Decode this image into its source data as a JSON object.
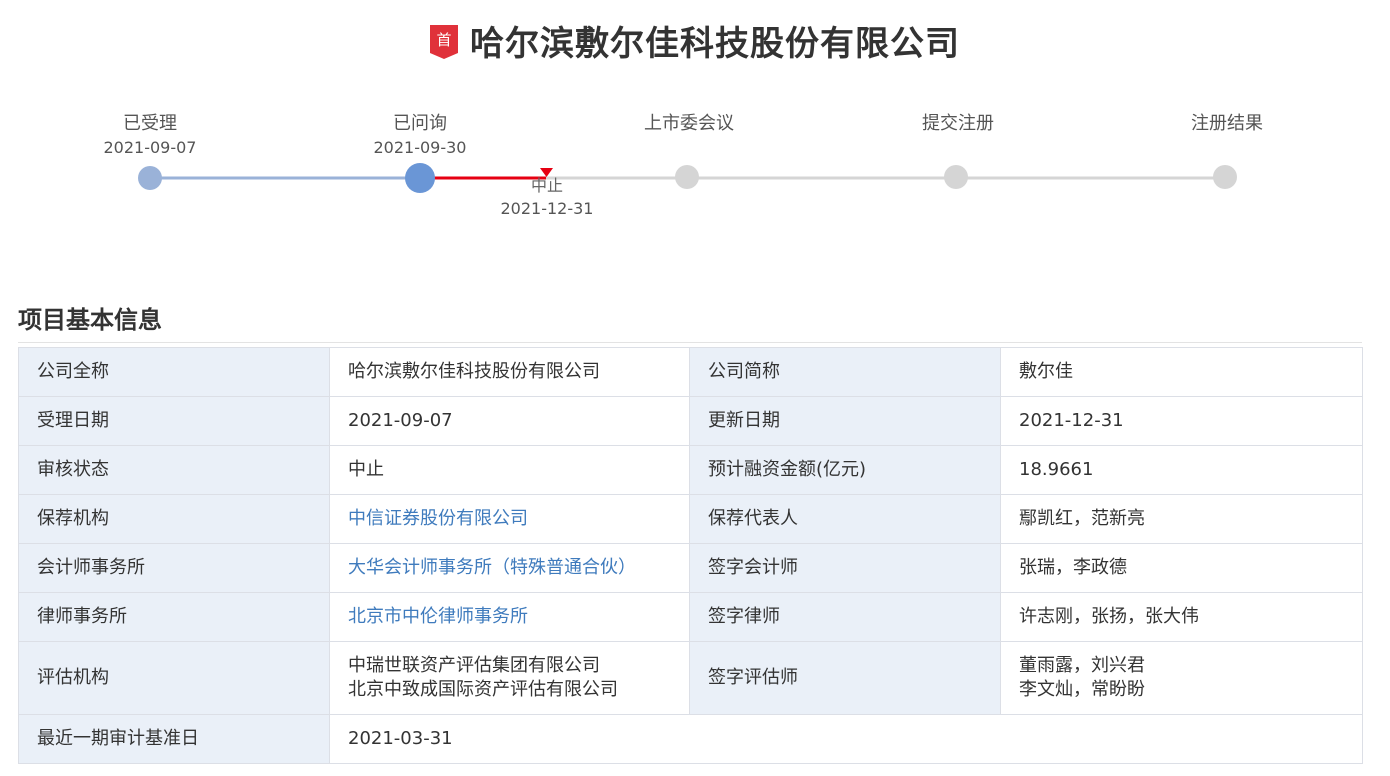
{
  "header": {
    "badge": "首",
    "title": "哈尔滨敷尔佳科技股份有限公司"
  },
  "timeline": {
    "stages": [
      {
        "name": "已受理",
        "date": "2021-09-07",
        "status": "done"
      },
      {
        "name": "已问询",
        "date": "2021-09-30",
        "status": "current"
      },
      {
        "name": "上市委会议",
        "date": "",
        "status": "pending"
      },
      {
        "name": "提交注册",
        "date": "",
        "status": "pending"
      },
      {
        "name": "注册结果",
        "date": "",
        "status": "pending"
      }
    ],
    "halt": {
      "name": "中止",
      "date": "2021-12-31"
    }
  },
  "section": {
    "title": "项目基本信息"
  },
  "info": {
    "rows": [
      {
        "k1": "公司全称",
        "v1": "哈尔滨敷尔佳科技股份有限公司",
        "k2": "公司简称",
        "v2": "敷尔佳"
      },
      {
        "k1": "受理日期",
        "v1": "2021-09-07",
        "k2": "更新日期",
        "v2": "2021-12-31"
      },
      {
        "k1": "审核状态",
        "v1": "中止",
        "k2": "预计融资金额(亿元)",
        "v2": "18.9661"
      },
      {
        "k1": "保荐机构",
        "v1": "中信证券股份有限公司",
        "k2": "保荐代表人",
        "v2": "鄢凯红，范新亮"
      },
      {
        "k1": "会计师事务所",
        "v1": "大华会计师事务所（特殊普通合伙）",
        "k2": "签字会计师",
        "v2": "张瑞，李政德"
      },
      {
        "k1": "律师事务所",
        "v1": "北京市中伦律师事务所",
        "k2": "签字律师",
        "v2": "许志刚，张扬，张大伟"
      },
      {
        "k1": "评估机构",
        "v1a": "中瑞世联资产评估集团有限公司",
        "v1b": "北京中致成国际资产评估有限公司",
        "k2": "签字评估师",
        "v2a": "董雨露，刘兴君",
        "v2b": "李文灿，常盼盼"
      },
      {
        "k1": "最近一期审计基准日",
        "v1": "2021-03-31"
      }
    ]
  },
  "colors": {
    "done": "#9ab2d8",
    "current": "#6a96d6",
    "pending": "#d5d5d5",
    "halt": "#e60012",
    "link": "#3f7bbd",
    "label_bg": "#eaf0f8"
  }
}
